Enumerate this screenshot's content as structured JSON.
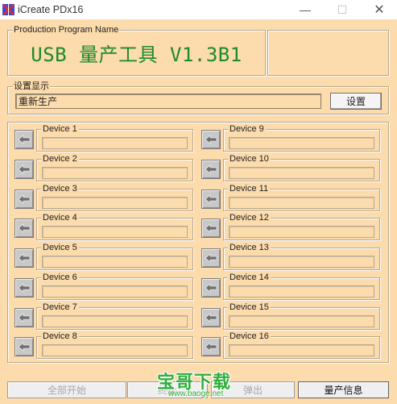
{
  "window": {
    "title": "iCreate PDx16",
    "controls": {
      "minimize": "—",
      "maximize": "☐",
      "close": "✕"
    }
  },
  "production": {
    "group_label": "Production Program Name",
    "program_name": "USB 量产工具 V1.3B1"
  },
  "settings": {
    "group_label": "设置显示",
    "display_value": "重新生产",
    "button_label": "设置"
  },
  "devices": [
    {
      "label": "Device 1"
    },
    {
      "label": "Device 2"
    },
    {
      "label": "Device 3"
    },
    {
      "label": "Device 4"
    },
    {
      "label": "Device 5"
    },
    {
      "label": "Device 6"
    },
    {
      "label": "Device 7"
    },
    {
      "label": "Device 8"
    },
    {
      "label": "Device 9"
    },
    {
      "label": "Device 10"
    },
    {
      "label": "Device 11"
    },
    {
      "label": "Device 12"
    },
    {
      "label": "Device 13"
    },
    {
      "label": "Device 14"
    },
    {
      "label": "Device 15"
    },
    {
      "label": "Device 16"
    }
  ],
  "bottom_buttons": {
    "start_all": "全部开始",
    "stop": "终止",
    "eject": "弹出",
    "production_info": "量产信息"
  },
  "watermark": {
    "brand": "宝哥下载",
    "url": "www.baoge.net"
  },
  "colors": {
    "background": "#fcdbac",
    "program_title": "#1d8a2c",
    "watermark": "#2fae3c"
  }
}
